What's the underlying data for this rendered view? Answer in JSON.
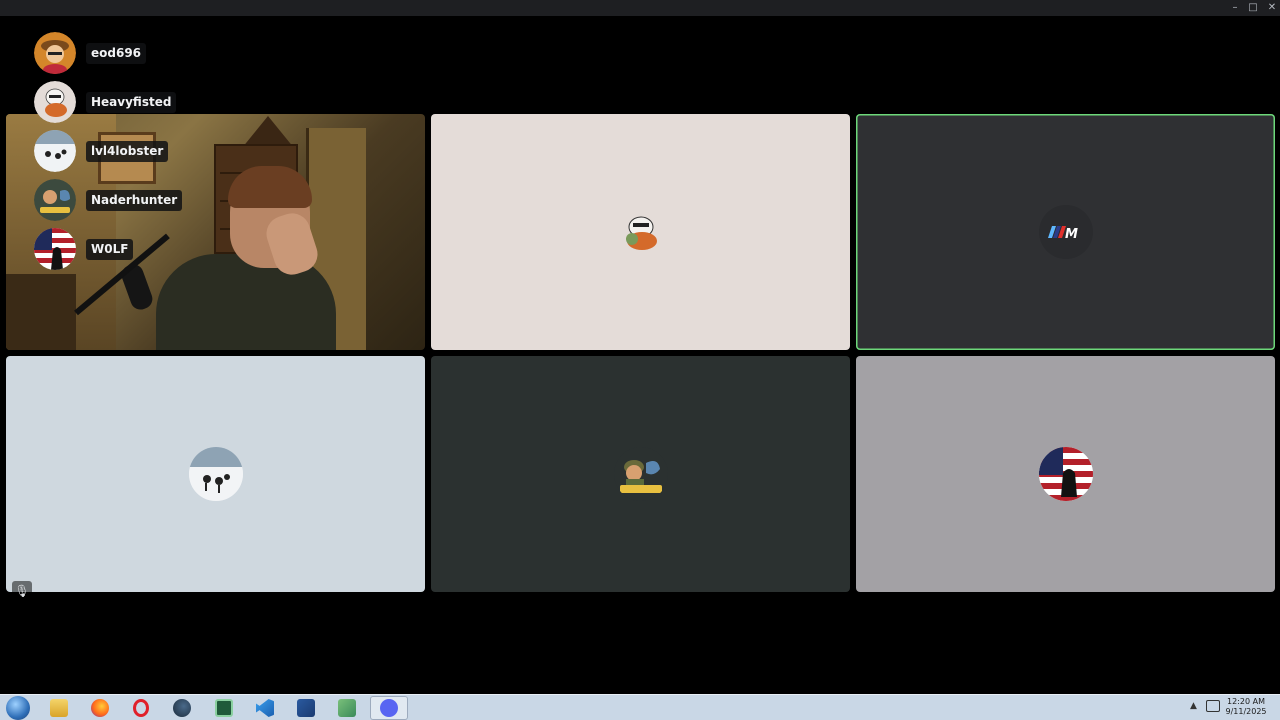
{
  "window": {
    "minimize_label": "–",
    "maximize_label": "□",
    "close_label": "✕"
  },
  "participants": [
    {
      "name": "eod696",
      "avatar_color": "#d4862a"
    },
    {
      "name": "Heavyfisted",
      "avatar_color": "#e4dcd8"
    },
    {
      "name": "lvl4lobster",
      "avatar_color": "#cfd8df"
    },
    {
      "name": "Naderhunter",
      "avatar_color": "#3c4a3e"
    },
    {
      "name": "W0LF",
      "avatar_color": "#7a1a22"
    }
  ],
  "tiles": [
    {
      "id": "camera",
      "bg": "#6b5a34"
    },
    {
      "id": "heavyfisted",
      "bg": "#e4dcd8",
      "avatar_icon": "cartoon-avatar-icon"
    },
    {
      "id": "bmw-m",
      "bg": "#2f3033",
      "avatar_icon": "bmw-m-logo-icon",
      "logo_text": "//M"
    },
    {
      "id": "lvl4lobster",
      "bg": "#cfd8df",
      "avatar_icon": "snow-avatar-icon"
    },
    {
      "id": "naderhunter",
      "bg": "#2b3130",
      "avatar_icon": "naderhunter-avatar-icon"
    },
    {
      "id": "w0lf",
      "bg": "#a3a1a5",
      "avatar_icon": "flag-avatar-icon"
    }
  ],
  "mute_icon": "mic-muted-icon",
  "taskbar": {
    "apps": [
      "windows-explorer-icon",
      "firefox-icon",
      "opera-icon",
      "steam-icon",
      "cheat-engine-icon",
      "vscode-icon",
      "visual-studio-icon",
      "network-tool-icon",
      "discord-icon"
    ],
    "active_app": "discord-icon",
    "clock_time": "12:20 AM",
    "clock_date": "9/11/2025"
  }
}
